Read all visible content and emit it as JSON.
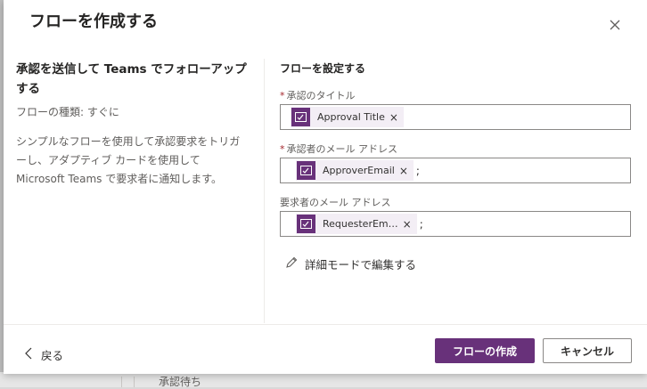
{
  "dialog": {
    "title": "フローを作成する",
    "close_icon": "close-icon"
  },
  "template": {
    "heading": "承認を送信して Teams でフォローアップする",
    "type": "フローの種類: すぐに",
    "description": "シンプルなフローを使用して承認要求をトリガーし、アダプティブ カードを使用して Microsoft Teams で要求者に通知します。"
  },
  "settings": {
    "section_title": "フローを設定する",
    "fields": [
      {
        "label": "承認のタイトル",
        "required": true,
        "token": "Approval Title",
        "suffix": ""
      },
      {
        "label": "承認者のメール アドレス",
        "required": true,
        "token": "ApproverEmail",
        "suffix": ";"
      },
      {
        "label": "要求者のメール アドレス",
        "required": false,
        "token": "RequesterEm…",
        "suffix": ";"
      }
    ],
    "required_mark": "*",
    "edit_link": "詳細モードで編集する"
  },
  "footer": {
    "back": "戻る",
    "create": "フローの作成",
    "cancel": "キャンセル"
  },
  "background": {
    "peek_text": "承認待ち"
  },
  "colors": {
    "accent": "#68317a",
    "token_bg": "#f3eef5",
    "required": "#a4262c"
  }
}
